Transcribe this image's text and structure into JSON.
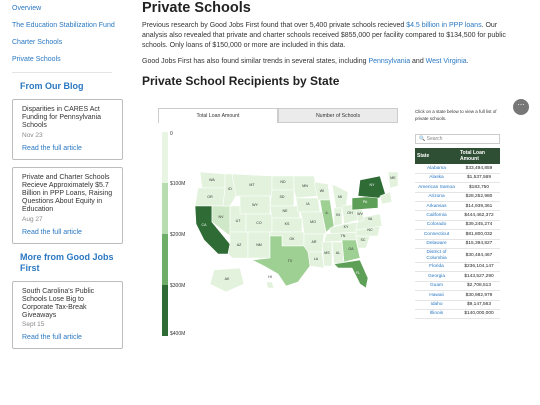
{
  "sidebar": {
    "links": [
      "Overview",
      "The Education Stabilization Fund",
      "Charter Schools",
      "Private Schools"
    ],
    "blog_heading": "From Our Blog",
    "blog_cards": [
      {
        "title": "Disparities in CARES Act Funding for Pennsylvania Schools",
        "date": "Nov 23",
        "link": "Read the full article"
      },
      {
        "title": "Private and Charter Schools Recieve Approximately $5.7 Billion in PPP Loans, Raising Questions About Equity in Education",
        "date": "Aug 27",
        "link": "Read the full article"
      }
    ],
    "more_heading": "More from Good Jobs First",
    "more_cards": [
      {
        "title": "South Carolina's Public Schools Lose Big to Corporate Tax-Break Giveaways",
        "date": "Sept 15",
        "link": "Read the full article"
      }
    ]
  },
  "main": {
    "title": "Private Schools",
    "para1_a": "Previous research by Good Jobs First found that over 5,400 private schools recieved ",
    "para1_link": "$4.5 billion in PPP loans",
    "para1_b": ". Our analysis also revealed that private and charter schools received $855,000 per facility compared to $134,500 for public schools. Only loans of $150,000 or more are included in this data.",
    "para2_a": "Good Jobs First has also found similar trends in several states, including ",
    "para2_link1": "Pennsylvania",
    "para2_mid": " and ",
    "para2_link2": "West Virginia",
    "para2_end": ".",
    "section_title": "Private School Recipients by State"
  },
  "widget": {
    "tabs": [
      "Total Loan Amount",
      "Number of Schools"
    ],
    "legend_labels": [
      "0",
      "$100M",
      "$200M",
      "$300M",
      "$400M"
    ],
    "legend_colors": [
      "#e8f5e2",
      "#b7dcb0",
      "#6fae68",
      "#2e6b35"
    ],
    "menu_icon": "⋯",
    "note": "Click on a state below to view a full list of private schools.",
    "search_placeholder": "Search",
    "table_headers": [
      "State",
      "Total Loan Amount"
    ],
    "table_rows": [
      [
        "Alabama",
        "$33,494,859"
      ],
      [
        "Alaska",
        "$1,537,569"
      ],
      [
        "American Samoa",
        "$183,750"
      ],
      [
        "Arizona",
        "$28,252,980"
      ],
      [
        "Arkansas",
        "$14,939,361"
      ],
      [
        "California",
        "$444,462,372"
      ],
      [
        "Colorado",
        "$39,245,274"
      ],
      [
        "Connecticut",
        "$81,800,032"
      ],
      [
        "Delaware",
        "$15,394,827"
      ],
      [
        "District of Columbia",
        "$30,484,467"
      ],
      [
        "Florida",
        "$236,104,147"
      ],
      [
        "Georgia",
        "$143,527,290"
      ],
      [
        "Guam",
        "$2,708,513"
      ],
      [
        "Hawaii",
        "$30,982,979"
      ],
      [
        "Idaho",
        "$9,147,563"
      ],
      [
        "Illinois",
        "$140,000,000"
      ]
    ],
    "state_labels": [
      "WA",
      "OR",
      "CA",
      "NV",
      "ID",
      "MT",
      "WY",
      "UT",
      "AZ",
      "CO",
      "NM",
      "ND",
      "SD",
      "NE",
      "KS",
      "OK",
      "TX",
      "MN",
      "IA",
      "MO",
      "AR",
      "LA",
      "WI",
      "IL",
      "MS",
      "AL",
      "TN",
      "KY",
      "IN",
      "OH",
      "MI",
      "GA",
      "FL",
      "SC",
      "NC",
      "VA",
      "WV",
      "PA",
      "NY",
      "ME",
      "AK",
      "HI"
    ]
  }
}
